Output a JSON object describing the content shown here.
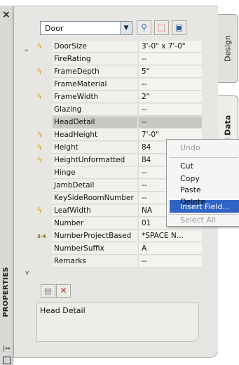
{
  "window": {
    "close_glyph": "×",
    "strip_title": "PROPERTIES",
    "tabs": [
      "Design",
      "Extended Data"
    ],
    "tab_visible_labels": [
      "Design",
      "ded Data"
    ]
  },
  "toolbar": {
    "object_type": "Door",
    "buttons": [
      "filter-icon",
      "select-objects-icon",
      "quick-select-icon"
    ]
  },
  "properties": [
    {
      "icon": "lightning",
      "name": "DoorSize",
      "value": "3'-0\" x 7'-0\""
    },
    {
      "icon": "",
      "name": "FireRating",
      "value": "--"
    },
    {
      "icon": "lightning",
      "name": "FrameDepth",
      "value": "5\""
    },
    {
      "icon": "",
      "name": "FrameMaterial",
      "value": "--"
    },
    {
      "icon": "lightning",
      "name": "FrameWidth",
      "value": "2\""
    },
    {
      "icon": "",
      "name": "Glazing",
      "value": "--"
    },
    {
      "icon": "",
      "name": "HeadDetail",
      "value": "--",
      "selected": true
    },
    {
      "icon": "lightning",
      "name": "HeadHeight",
      "value": "7'-0\""
    },
    {
      "icon": "lightning",
      "name": "Height",
      "value": "84"
    },
    {
      "icon": "lightning",
      "name": "HeightUnformatted",
      "value": "84"
    },
    {
      "icon": "",
      "name": "Hinge",
      "value": "--"
    },
    {
      "icon": "",
      "name": "JambDetail",
      "value": "--"
    },
    {
      "icon": "",
      "name": "KeySideRoomNumber",
      "value": "--"
    },
    {
      "icon": "lightning",
      "name": "LeafWidth",
      "value": "NA"
    },
    {
      "icon": "",
      "name": "Number",
      "value": "01"
    },
    {
      "icon": "number",
      "name": "NumberProjectBased",
      "value": "*SPACE N..."
    },
    {
      "icon": "",
      "name": "NumberSuffix",
      "value": "A"
    },
    {
      "icon": "",
      "name": "Remarks",
      "value": "--"
    }
  ],
  "description": "Head Detail",
  "context_menu": {
    "items": [
      {
        "label": "Undo",
        "enabled": false
      },
      {
        "label": "Cut",
        "enabled": true
      },
      {
        "label": "Copy",
        "enabled": true
      },
      {
        "label": "Paste",
        "enabled": true
      },
      {
        "label": "Delete",
        "enabled": true
      },
      {
        "label": "Insert Field...",
        "enabled": true,
        "highlighted": true
      },
      {
        "label": "Select All",
        "enabled": false
      }
    ]
  },
  "colors": {
    "panel": "#e7e6e2",
    "selection": "#c9c8c3",
    "menu_highlight": "#3163c5",
    "property_icon": "#c79a0a"
  }
}
